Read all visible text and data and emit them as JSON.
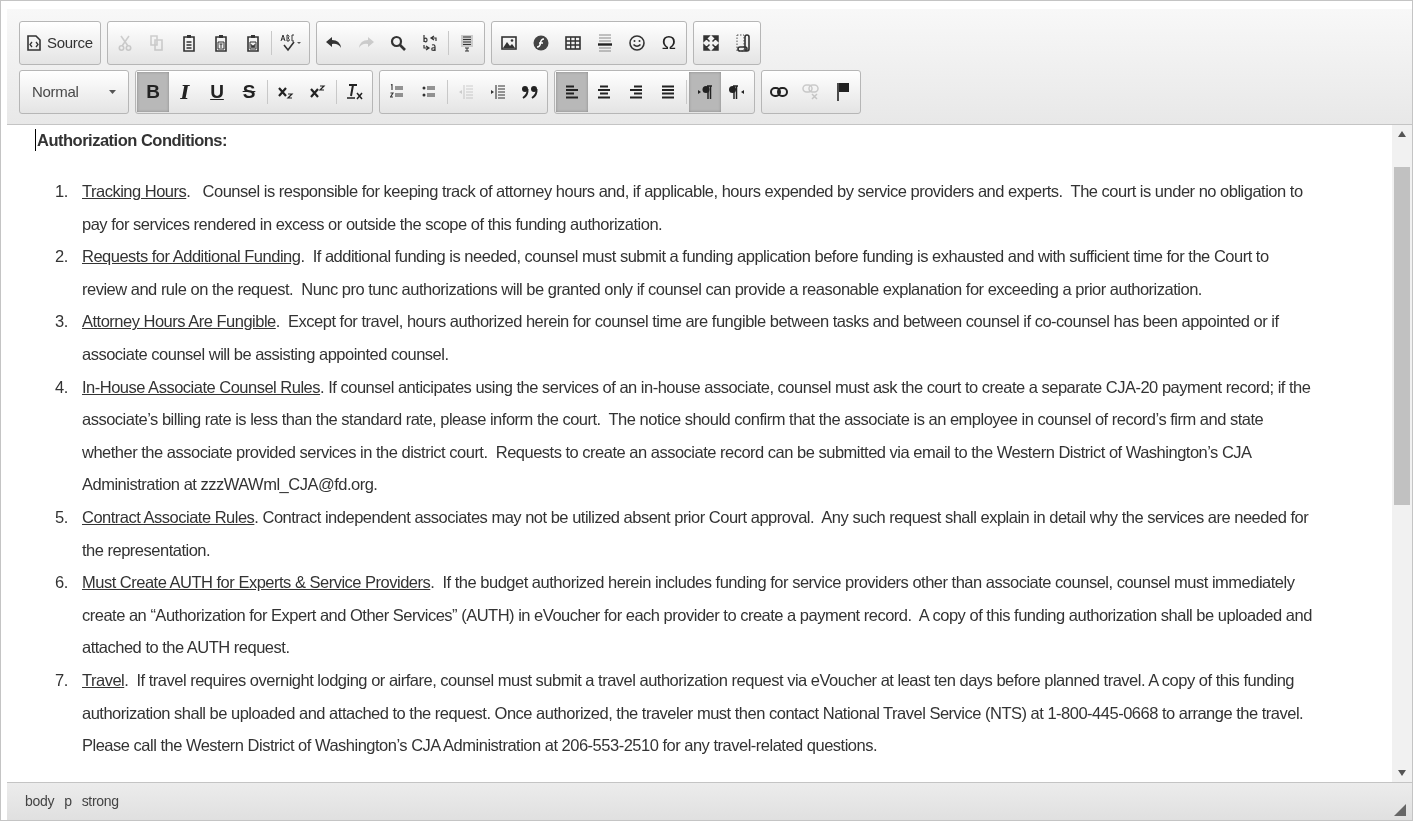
{
  "toolbar_rows": [
    [
      {
        "buttons": [
          {
            "kind": "source",
            "label": "Source",
            "on": false,
            "disabled": false
          }
        ]
      },
      {
        "buttons": [
          {
            "kind": "cut",
            "on": false,
            "disabled": true
          },
          {
            "kind": "copy",
            "on": false,
            "disabled": true
          },
          {
            "kind": "paste",
            "on": false,
            "disabled": false
          },
          {
            "kind": "paste-text",
            "on": false,
            "disabled": false
          },
          {
            "kind": "paste-word",
            "on": false,
            "disabled": false
          },
          {
            "kind": "sep"
          },
          {
            "kind": "spellcheck",
            "on": false,
            "disabled": false
          }
        ]
      },
      {
        "buttons": [
          {
            "kind": "undo",
            "on": false,
            "disabled": false
          },
          {
            "kind": "redo",
            "on": false,
            "disabled": true
          },
          {
            "kind": "find",
            "on": false,
            "disabled": false
          },
          {
            "kind": "replace",
            "on": false,
            "disabled": false
          },
          {
            "kind": "sep"
          },
          {
            "kind": "select-all",
            "on": false,
            "disabled": false
          }
        ]
      },
      {
        "buttons": [
          {
            "kind": "image",
            "on": false,
            "disabled": false
          },
          {
            "kind": "flash",
            "on": false,
            "disabled": false
          },
          {
            "kind": "table",
            "on": false,
            "disabled": false
          },
          {
            "kind": "hline",
            "on": false,
            "disabled": false
          },
          {
            "kind": "smiley",
            "on": false,
            "disabled": false
          },
          {
            "kind": "glyph",
            "label": "Ω",
            "on": false,
            "disabled": false
          }
        ]
      },
      {
        "buttons": [
          {
            "kind": "maximize",
            "on": false,
            "disabled": false
          },
          {
            "kind": "blocks",
            "on": false,
            "disabled": false
          }
        ]
      }
    ],
    [
      {
        "format": "Normal"
      },
      {
        "buttons": [
          {
            "kind": "bold",
            "label": "B",
            "on": true,
            "disabled": false
          },
          {
            "kind": "italic",
            "label": "I",
            "on": false,
            "disabled": false
          },
          {
            "kind": "underline",
            "label": "U",
            "on": false,
            "disabled": false
          },
          {
            "kind": "strike",
            "label": "S",
            "on": false,
            "disabled": false
          },
          {
            "kind": "sep"
          },
          {
            "kind": "subscript",
            "on": false,
            "disabled": false
          },
          {
            "kind": "superscript",
            "on": false,
            "disabled": false
          },
          {
            "kind": "sep"
          },
          {
            "kind": "remove-format",
            "on": false,
            "disabled": false
          }
        ]
      },
      {
        "buttons": [
          {
            "kind": "numbered-list",
            "on": false,
            "disabled": false
          },
          {
            "kind": "bulleted-list",
            "on": false,
            "disabled": false
          },
          {
            "kind": "sep"
          },
          {
            "kind": "outdent",
            "on": false,
            "disabled": true
          },
          {
            "kind": "indent",
            "on": false,
            "disabled": false
          },
          {
            "kind": "blockquote",
            "on": false,
            "disabled": false
          }
        ]
      },
      {
        "buttons": [
          {
            "kind": "align-left",
            "on": true,
            "disabled": false
          },
          {
            "kind": "align-center",
            "on": false,
            "disabled": false
          },
          {
            "kind": "align-right",
            "on": false,
            "disabled": false
          },
          {
            "kind": "justify",
            "on": false,
            "disabled": false
          },
          {
            "kind": "sep"
          },
          {
            "kind": "ltr",
            "on": true,
            "disabled": false
          },
          {
            "kind": "rtl",
            "on": false,
            "disabled": false
          }
        ]
      },
      {
        "buttons": [
          {
            "kind": "link",
            "on": false,
            "disabled": false
          },
          {
            "kind": "unlink",
            "on": false,
            "disabled": true
          },
          {
            "kind": "anchor",
            "on": false,
            "disabled": false
          }
        ]
      }
    ]
  ],
  "content": {
    "heading": "Authorization Conditions:",
    "items": [
      {
        "number": "1.",
        "title": "Tracking Hours",
        "text": ".   Counsel is responsible for keeping track of attorney hours and, if applicable, hours expended by service providers and experts.  The court is under no obligation to pay for services rendered in excess or outside the scope of this funding authorization."
      },
      {
        "number": "2.",
        "title": "Requests for Additional Funding",
        "text": ".  If additional funding is needed, counsel must submit a funding application before funding is exhausted and with sufficient time for the Court to review and rule on the request.  Nunc pro tunc authorizations will be granted only if counsel can provide a reasonable explanation for exceeding a prior authorization."
      },
      {
        "number": "3.",
        "title": "Attorney Hours Are Fungible",
        "text": ".  Except for travel, hours authorized herein for counsel time are fungible between tasks and between counsel if co-counsel has been appointed or if associate counsel will be assisting appointed counsel."
      },
      {
        "number": "4.",
        "title": "In-House Associate Counsel Rules",
        "text": ". If counsel anticipates using the services of an in-house associate, counsel must ask the court to create a separate CJA-20 payment record; if the associate’s billing rate is less than the standard rate, please inform the court.  The notice should confirm that the associate is an employee in counsel of record’s firm and state whether the associate provided services in the district court.  Requests to create an associate record can be submitted via email to the Western District of Washington’s CJA Administration at zzzWAWml_CJA@fd.org."
      },
      {
        "number": "5.",
        "title": "Contract Associate Rules",
        "text": ". Contract independent associates may not be utilized absent prior Court approval.  Any such request shall explain in detail why the services are needed for the representation."
      },
      {
        "number": "6.",
        "title": "Must Create AUTH for Experts & Service Providers",
        "text": ".  If the budget authorized herein includes funding for service providers other than associate counsel, counsel must immediately create an “Authorization for Expert and Other Services” (AUTH) in eVoucher for each provider to create a payment record.  A copy of this funding authorization shall be uploaded and attached to the AUTH request."
      },
      {
        "number": "7.",
        "title": "Travel",
        "text": ".  If travel requires overnight lodging or airfare, counsel must submit a travel authorization request via eVoucher at least ten days before planned travel. A copy of this funding authorization shall be uploaded and attached to the request. Once authorized, the traveler must then contact National Travel Service (NTS) at 1-800-445-0668 to arrange the travel.  Please call the Western District of Washington’s CJA Administration at 206-553-2510 for any travel-related questions."
      }
    ]
  },
  "status_bar": {
    "path": [
      "body",
      "p",
      "strong"
    ]
  }
}
